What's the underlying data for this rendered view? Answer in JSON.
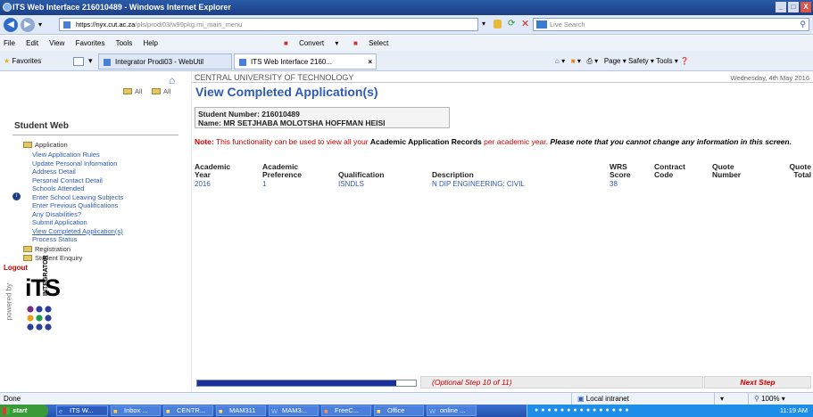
{
  "window": {
    "title": "ITS Web Interface 216010489 - Windows Internet Explorer",
    "controls": [
      "_",
      "□",
      "X"
    ]
  },
  "nav": {
    "url_host": "https://nyx.cut.ac.za",
    "url_path": "/pls/prodi03/w99pkg.mi_main_menu",
    "search_placeholder": "Live Search"
  },
  "menubar": [
    "File",
    "Edit",
    "View",
    "Favorites",
    "Tools",
    "Help"
  ],
  "convert": {
    "convert_label": "Convert",
    "select_label": "Select"
  },
  "favbar": {
    "favorites_label": "Favorites",
    "tab1": "Integrator Prodi03 - WebUtil",
    "tab2": "ITS Web Interface 2160...",
    "tools_text": "Page ▾   Safety ▾   Tools ▾"
  },
  "sidebar": {
    "all_open": "All",
    "all_closed": "All",
    "heading": "Student Web",
    "groups": {
      "application": "Application",
      "registration": "Registration",
      "enquiry": "Student Enquiry"
    },
    "items": [
      "View Application Rules",
      "Update Personal Information",
      "Address Detail",
      "Personal Contact Detail",
      "Schools Attended",
      "Enter School Leaving Subjects",
      "Enter Previous Qualifications",
      "Any Disabilities?",
      "Submit Application",
      "View Completed Application(s)",
      "Process Status"
    ],
    "logout": "Logout",
    "powered_by": "powered by",
    "logo_text": "iTS",
    "logo_sub": "INTEGRATOR"
  },
  "main": {
    "university": "CENTRAL UNIVERSITY OF TECHNOLOGY",
    "date": "Wednesday, 4th May 2016",
    "title": "View Completed Application(s)",
    "student_number": "Student Number: 216010489",
    "student_name": "Name: MR SETJHABA MOLOTSHA HOFFMAN HEISI",
    "note_label": "Note:",
    "note_text1": "This functionality can be used to view all your",
    "note_bold": "Academic Application Records",
    "note_text2": "per academic year.",
    "note_italic": "Please note that you cannot change any information in this screen.",
    "table": {
      "headers": [
        [
          "Academic",
          "Year"
        ],
        [
          "Academic",
          "Preference"
        ],
        [
          "",
          "Qualification"
        ],
        [
          "",
          "Description"
        ],
        [
          "WRS",
          "Score"
        ],
        [
          "Contract",
          "Code"
        ],
        [
          "Quote",
          "Number"
        ],
        [
          "Quote",
          "Total"
        ]
      ],
      "rows": [
        [
          "2016",
          "1",
          "ISNDLS",
          "N DIP ENGINEERING: CIVIL",
          "38",
          "",
          "",
          ""
        ]
      ]
    },
    "progress_fraction": 0.91,
    "step_text": "(Optional Step 10 of 11)",
    "next_step": "Next Step"
  },
  "status": {
    "left": "Done",
    "zone": "Local intranet",
    "zoom": "100%"
  },
  "taskbar": {
    "start": "start",
    "buttons": [
      "ITS W...",
      "Inbox ...",
      "CENTR...",
      "MAM311",
      "MAM3...",
      "FreeC...",
      "Office",
      "online ..."
    ],
    "clock": "11:19 AM"
  },
  "colors": {
    "title_blue": "#2d5bb5",
    "note_red": "#cc0000",
    "step_red": "#cc0000",
    "progress_blue": "#1a2f9c"
  }
}
